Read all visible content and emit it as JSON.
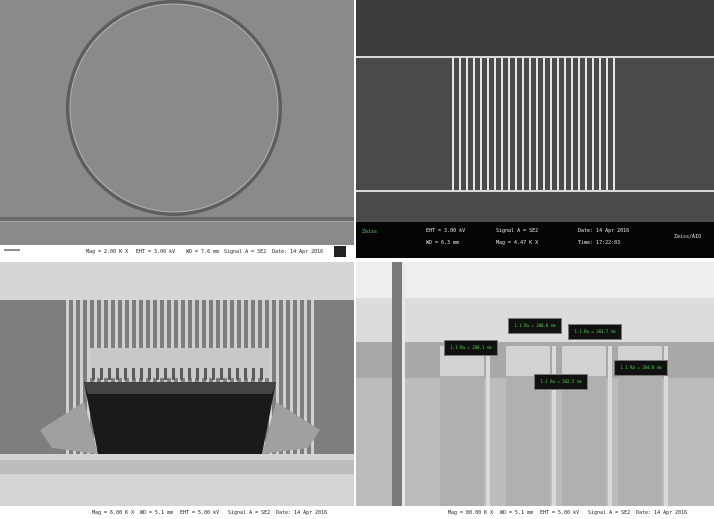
{
  "panels": [
    {
      "name": "sem-ring",
      "footer": [
        "Mag = 2.00 K X",
        "EHT = 3.00 kV",
        "WD = 7.6 mm",
        "Signal A = SE2",
        "Date: 14 Apr 2016"
      ]
    },
    {
      "name": "sem-grating",
      "logo": "Zeiss",
      "footer_row1": [
        "EHT = 3.00 kV",
        "Signal A = SE2",
        "Date: 14 Apr 2016"
      ],
      "footer_row2": [
        "WD = 6.3 mm",
        "Mag = 4.47 K X",
        "Time: 17:22:03"
      ],
      "brand": "Zeiss/AIO"
    },
    {
      "name": "sem-fib-trench",
      "footer": [
        "Mag = 6.00 K X",
        "WD = 5.1 mm",
        "EHT = 5.00 kV",
        "Signal A = SE2",
        "Date: 14 Apr 2016"
      ]
    },
    {
      "name": "sem-cross-section",
      "footer": [
        "Mag = 80.00 K X",
        "WD = 5.1 mm",
        "EHT = 5.00 kV",
        "Signal A = SE2",
        "Date: 14 Apr 2016"
      ],
      "measurements": [
        "1.1 Ra = 208.1 nm",
        "1.1 Ra = 200.0 nm",
        "1.1 Ra = 203.7 nm",
        "1.1 Ra = 202.5 nm",
        "1.1 Ra = 204.8 nm"
      ]
    }
  ],
  "colors": {
    "measurement_text": "#48d848",
    "background": "#ffffff"
  }
}
